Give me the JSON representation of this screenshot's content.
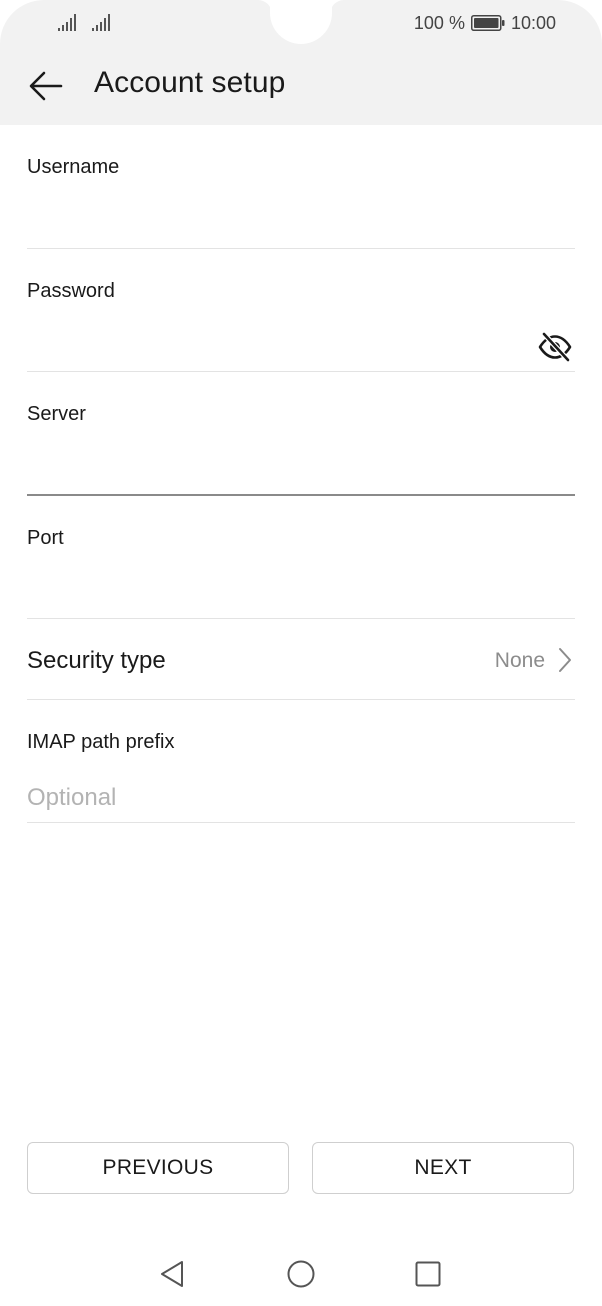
{
  "status_bar": {
    "battery_text": "100 %",
    "time": "10:00"
  },
  "toolbar": {
    "title": "Account setup"
  },
  "form": {
    "username": {
      "label": "Username",
      "value": "",
      "placeholder": ""
    },
    "password": {
      "label": "Password",
      "value": "",
      "placeholder": ""
    },
    "server": {
      "label": "Server",
      "value": "",
      "placeholder": ""
    },
    "port": {
      "label": "Port",
      "value": "",
      "placeholder": ""
    },
    "security_type": {
      "label": "Security type",
      "value": "None"
    },
    "imap_prefix": {
      "label": "IMAP path prefix",
      "value": "",
      "placeholder": "Optional"
    }
  },
  "buttons": {
    "previous": "PREVIOUS",
    "next": "NEXT"
  },
  "icons": {
    "back": "arrow-left-icon",
    "password_visibility": "eye-off-icon",
    "security_chevron": "chevron-right-icon",
    "nav_back": "triangle-back-icon",
    "nav_home": "circle-home-icon",
    "nav_recents": "square-recents-icon"
  },
  "colors": {
    "header_bg": "#f2f2f2",
    "text_primary": "#1a1a1a",
    "text_secondary": "#8c8c8c",
    "placeholder": "#b3b3b3",
    "divider": "#e3e3e3",
    "active_divider": "#8a8a8a"
  }
}
